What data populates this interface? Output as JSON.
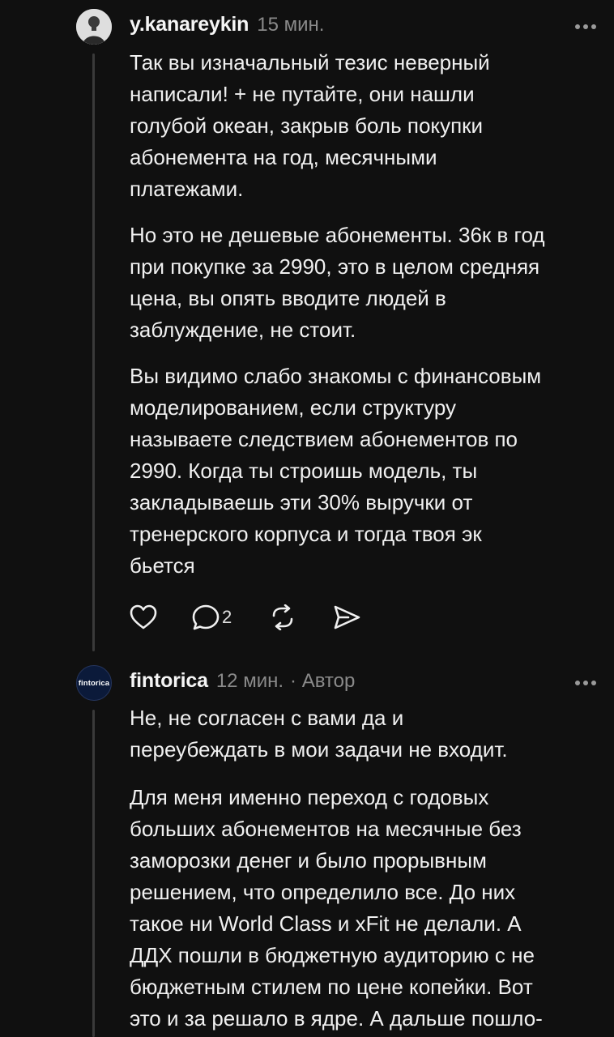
{
  "comments": [
    {
      "username": "y.kanareykin",
      "time": "15 мин.",
      "paragraphs": [
        "Так вы изначальный тезис неверный\nнаписали! + не путайте, они нашли\nголубой океан, закрыв боль покупки\nабонемента на год, месячными\nплатежами.",
        "Но это не дешевые абонементы. 36к в год\nпри покупке за 2990, это в целом средняя\nцена, вы опять вводите людей в\nзаблуждение, не стоит.",
        "Вы видимо слабо знакомы с финансовым\nмоделированием, если структуру\nназываете следствием абонементов по\n2990. Когда ты строишь модель, ты\nзакладываешь эти 30% выручки от\nтренерского корпуса  и тогда твоя эк\nбьется"
      ],
      "reply_count": "2",
      "icons": [
        "heart-icon",
        "comment-icon",
        "repost-icon",
        "share-icon",
        "more-icon"
      ]
    },
    {
      "username": "fintorica",
      "avatar_text": "fintorica",
      "time": "12 мин.",
      "badge": "· Автор",
      "paragraphs": [
        "Не, не согласен с вами да и\nпереубеждать в мои задачи не входит.",
        "Для меня именно переход с годовых\nбольших абонементов на месячные без\nзаморозки денег и было прорывным\nрешением, что определило все. До них\nтакое ни World Class и xFit не делали. А\nДДХ пошли в бюджетную аудиторию с не\nбюджетным стилем по цене копейки. Вот\nэто и за решало в ядре. А дальше пошло-"
      ]
    }
  ],
  "colors": {
    "background": "#101010",
    "text": "#f0f0f0",
    "muted": "#8a8a8a",
    "thread_line": "#3a3a3a",
    "brand_avatar": "#0b1a3a"
  }
}
